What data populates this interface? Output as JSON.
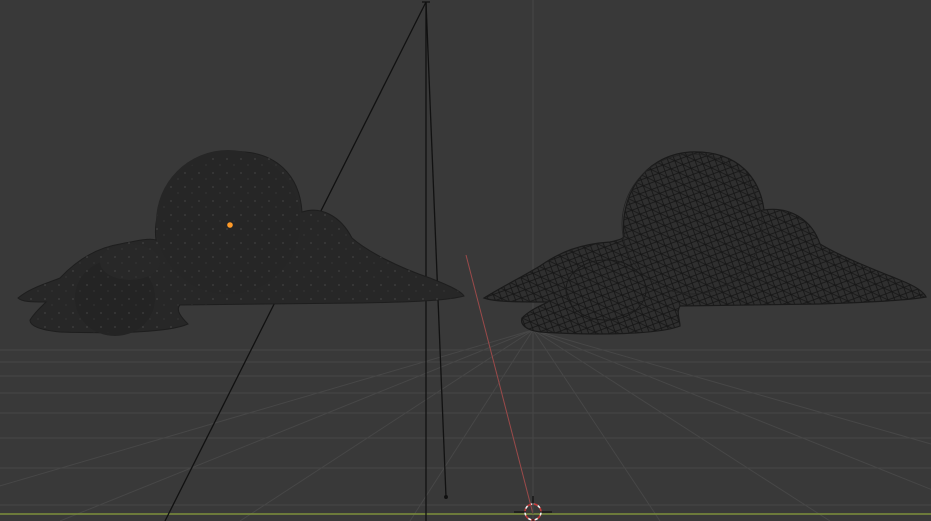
{
  "viewport": {
    "background": "#393939",
    "grid_color": "#464646",
    "x_axis_color": "#7d8f3c",
    "y_axis_color": "#9b4a4a",
    "solid_cloud_color": "#272727",
    "wire_cloud_color": "#1c1c1c",
    "origin_color": "#ff9a28",
    "cursor_colors": [
      "#c23b3b",
      "#f2f2f2"
    ]
  },
  "objects": [
    {
      "name": "cloud-solid",
      "shading": "solid",
      "selected": true
    },
    {
      "name": "cloud-wireframe",
      "shading": "wireframe",
      "selected": false
    }
  ],
  "scene_items": [
    "camera",
    "3d-cursor",
    "grid-floor"
  ]
}
